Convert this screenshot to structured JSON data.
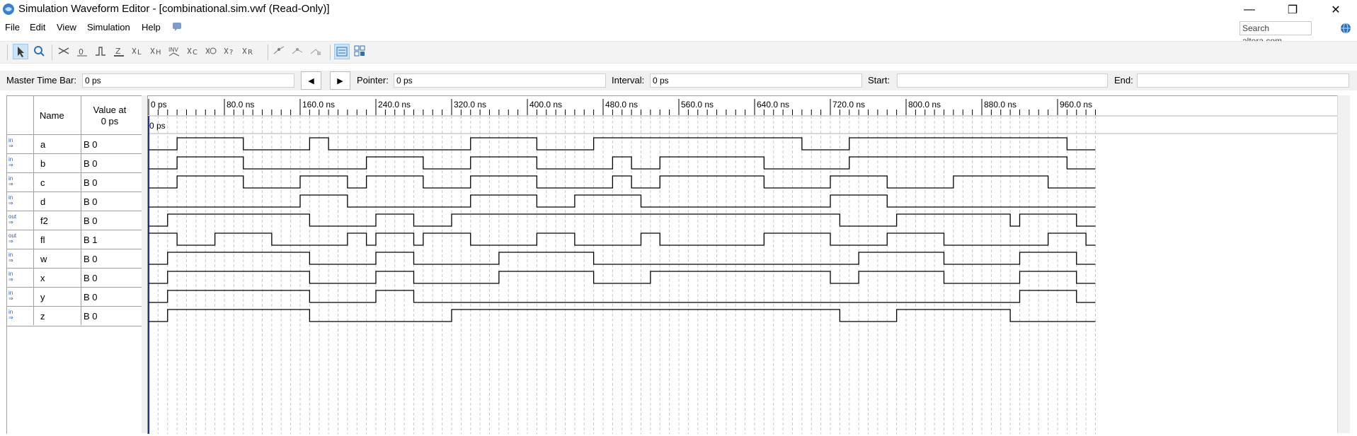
{
  "window": {
    "title": "Simulation Waveform Editor - [combinational.sim.vwf (Read-Only)]",
    "minimize": "—",
    "restore": "❐",
    "close": "✕"
  },
  "menu": [
    "File",
    "Edit",
    "View",
    "Simulation",
    "Help"
  ],
  "search": {
    "placeholder": "Search altera.com"
  },
  "timebar": {
    "master_label": "Master Time Bar:",
    "master_value": "0 ps",
    "pointer_label": "Pointer:",
    "pointer_value": "0 ps",
    "interval_label": "Interval:",
    "interval_value": "0 ps",
    "start_label": "Start:",
    "start_value": "",
    "end_label": "End:",
    "end_value": ""
  },
  "columns": {
    "name": "Name",
    "value_line1": "Value at",
    "value_line2": "0 ps"
  },
  "time_axis": {
    "labels": [
      "0 ps",
      "80.0 ns",
      "160.0 ns",
      "240.0 ns",
      "320.0 ns",
      "400.0 ns",
      "480.0 ns",
      "560.0 ns",
      "640.0 ns",
      "720.0 ns",
      "800.0 ns",
      "880.0 ns",
      "960.0 ns"
    ],
    "cursor_label": "0 ps",
    "max_ns": 1000
  },
  "signals": [
    {
      "dir": "in",
      "name": "a",
      "value": "B 0",
      "edges": [
        0,
        30,
        100,
        170,
        190,
        340,
        410,
        470,
        690,
        740,
        970
      ],
      "start": 0
    },
    {
      "dir": "in",
      "name": "b",
      "value": "B 0",
      "edges": [
        0,
        30,
        100,
        230,
        290,
        340,
        410,
        490,
        510,
        540,
        650,
        740,
        970
      ],
      "start": 0
    },
    {
      "dir": "in",
      "name": "c",
      "value": "B 0",
      "edges": [
        0,
        30,
        100,
        160,
        210,
        230,
        290,
        340,
        410,
        490,
        510,
        540,
        650,
        720,
        780,
        850,
        950
      ],
      "start": 0
    },
    {
      "dir": "in",
      "name": "d",
      "value": "B 0",
      "edges": [
        0,
        160,
        210,
        340,
        410,
        450,
        520,
        720,
        780
      ],
      "start": 0
    },
    {
      "dir": "out",
      "name": "f2",
      "value": "B 0",
      "edges": [
        0,
        20,
        170,
        240,
        280,
        320,
        730,
        790,
        910,
        920,
        980
      ],
      "start": 0
    },
    {
      "dir": "out",
      "name": "fl",
      "value": "B 1",
      "edges": [
        0,
        30,
        70,
        130,
        210,
        230,
        240,
        280,
        290,
        340,
        410,
        450,
        520,
        540,
        650,
        720,
        780,
        840,
        950,
        990
      ],
      "start": 1
    },
    {
      "dir": "in",
      "name": "w",
      "value": "B 0",
      "edges": [
        0,
        20,
        170,
        240,
        280,
        370,
        470,
        750,
        840,
        920,
        980
      ],
      "start": 0
    },
    {
      "dir": "in",
      "name": "x",
      "value": "B 0",
      "edges": [
        0,
        20,
        170,
        240,
        280,
        370,
        470,
        530,
        720,
        750,
        840,
        920,
        980
      ],
      "start": 0
    },
    {
      "dir": "in",
      "name": "y",
      "value": "B 0",
      "edges": [
        0,
        20,
        170,
        240,
        280,
        920,
        980
      ],
      "start": 0
    },
    {
      "dir": "in",
      "name": "z",
      "value": "B 0",
      "edges": [
        0,
        20,
        170,
        320,
        730,
        790,
        910
      ],
      "start": 0
    }
  ]
}
